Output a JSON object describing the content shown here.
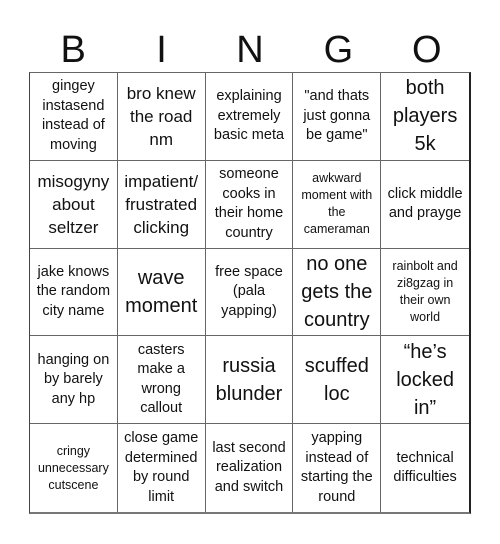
{
  "header": {
    "letters": [
      "B",
      "I",
      "N",
      "G",
      "O"
    ]
  },
  "cells": [
    [
      "gingey instasend instead of moving",
      "bro knew the road nm",
      "explaining extremely basic meta",
      "\"and thats just gonna be game\"",
      "both players 5k"
    ],
    [
      "misogyny about seltzer",
      "impatient/ frustrated clicking",
      "someone cooks in their home country",
      "awkward moment with the cameraman",
      "click middle and prayge"
    ],
    [
      "jake knows the random city name",
      "wave moment",
      "free space (pala yapping)",
      "no one gets the country",
      "rainbolt and zi8gzag in their own world"
    ],
    [
      "hanging on by barely any hp",
      "casters make a wrong callout",
      "russia blunder",
      "scuffed loc",
      "“he’s locked in”"
    ],
    [
      "cringy unnecessary cutscene",
      "close game determined by round limit",
      "last second realization and switch",
      "yapping instead of starting the round",
      "technical difficulties"
    ]
  ]
}
